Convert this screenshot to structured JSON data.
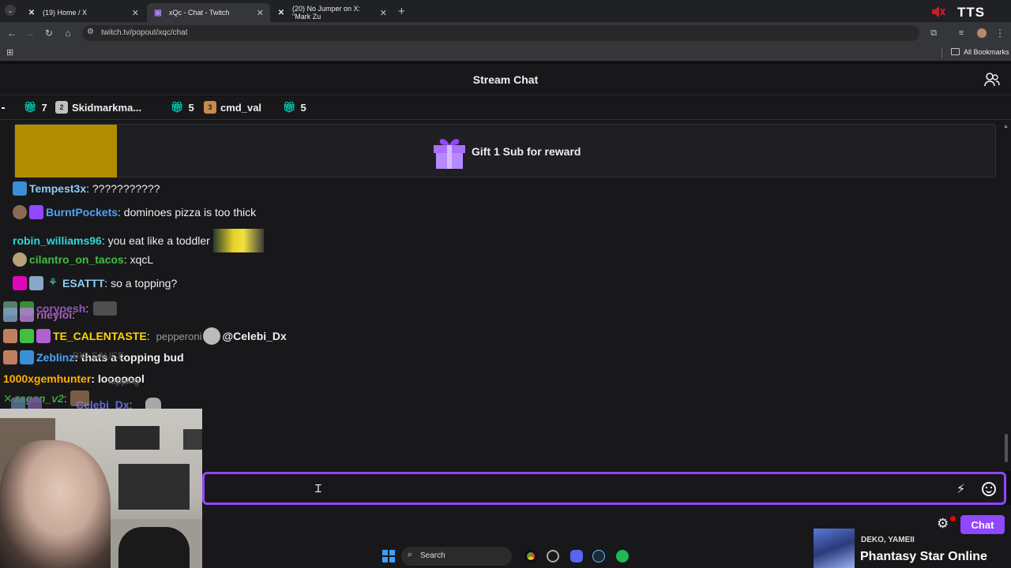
{
  "browser": {
    "tabs": [
      {
        "label": "(19) Home / X",
        "icon": "x-logo-icon"
      },
      {
        "label": "xQc - Chat - Twitch",
        "icon": "twitch-logo-icon"
      },
      {
        "label": "(20) No Jumper on X: \"Mark Zu",
        "icon": "x-logo-icon"
      }
    ],
    "url": "twitch.tv/popout/xqc/chat",
    "bookmarks_label": "All Bookmarks",
    "tts_label": "TTS"
  },
  "twitch": {
    "header_title": "Stream Chat",
    "gift_leaderboard": [
      {
        "count": "7"
      },
      {
        "rank": "2",
        "name": "Skidmarkma..."
      },
      {
        "count": "5"
      },
      {
        "rank": "3",
        "name": "cmd_val"
      },
      {
        "count": "5"
      }
    ],
    "reward_label": "Gift 1 Sub for reward",
    "messages": [
      {
        "user": "Tempest3x",
        "color": "#8ecdf5",
        "text": ": ???????????"
      },
      {
        "user": "BurntPockets",
        "color": "#4fa3f7",
        "text": ": dominoes pizza is too thick"
      },
      {
        "user": "robin_williams96",
        "color": "#2fd6d6",
        "text": ": you eat like a toddler"
      },
      {
        "user": "cilantro_on_tacos",
        "color": "#3fbf3f",
        "text": ": xqcL"
      },
      {
        "user": "ESATTT",
        "color": "#8ecdf5",
        "text": ": so a topping?"
      },
      {
        "user": "coryoesh",
        "color": "#a15bd9",
        "text": ":"
      },
      {
        "user": "rileyloi",
        "color": "#c06fd1",
        "text": ":"
      },
      {
        "user": "TE_CALENTASTE",
        "color": "#ffd400",
        "text": ":"
      },
      {
        "user": "@Celebi_Dx",
        "color": "#efeff1",
        "text": ""
      },
      {
        "user": "Zeblinz",
        "color": "#4fa3f7",
        "text": ": thats a topping bud"
      },
      {
        "user": "1000xgemhunter",
        "color": "#ffb000",
        "text": ": looooool"
      },
      {
        "user": "zagan_v2",
        "color": "#3fbf3f",
        "text": ":"
      },
      {
        "user": "Celebi_Dx",
        "color": "#7a7aff",
        "text": ":"
      }
    ],
    "overlap_text": {
      "t1": "pepperoni",
      "t2": "BIG SAUCE",
      "t3": "topping"
    },
    "chat_button": "Chat"
  },
  "overlay": {
    "now_playing_artist": "DEKO, YAMEII",
    "now_playing_title": "Phantasy Star Online"
  },
  "taskbar": {
    "search_label": "Search"
  }
}
